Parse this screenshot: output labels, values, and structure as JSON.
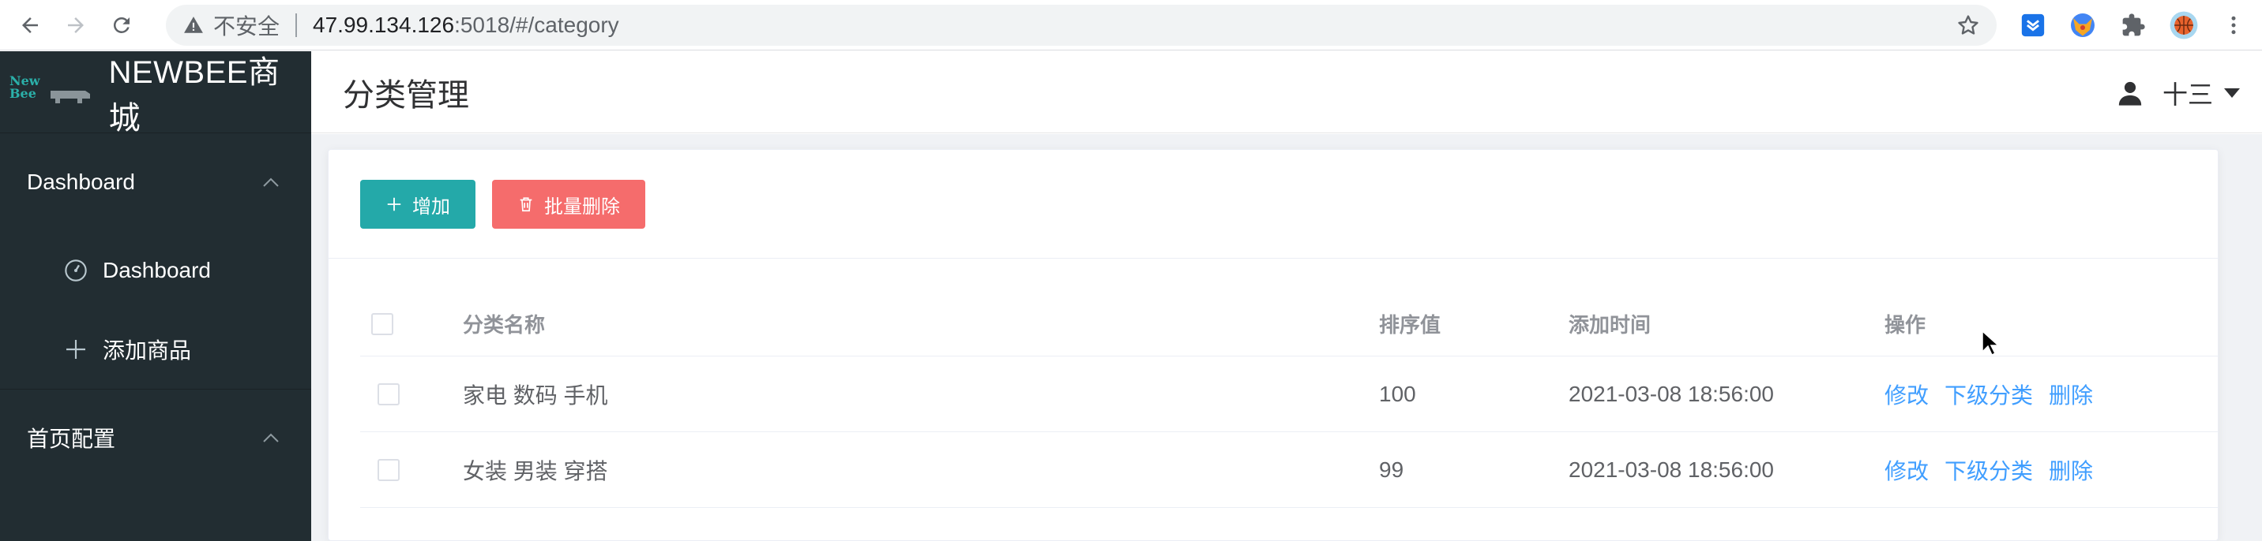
{
  "browser": {
    "insecure_label": "不安全",
    "url_host": "47.99.134.126",
    "url_path": ":5018/#/category"
  },
  "sidebar": {
    "brand": "NEWBEE商城",
    "logo_lines": [
      "New",
      "Bee"
    ],
    "groups": [
      {
        "label": "Dashboard",
        "items": [
          {
            "label": "Dashboard",
            "icon": "gauge-icon"
          },
          {
            "label": "添加商品",
            "icon": "plus-icon"
          }
        ]
      },
      {
        "label": "首页配置",
        "items": []
      }
    ]
  },
  "header": {
    "title": "分类管理",
    "user_name": "十三"
  },
  "toolbar": {
    "add_label": "增加",
    "batch_delete_label": "批量删除"
  },
  "table": {
    "columns": [
      "分类名称",
      "排序值",
      "添加时间",
      "操作"
    ],
    "rows": [
      {
        "name": "家电 数码 手机",
        "sort": "100",
        "time": "2021-03-08 18:56:00"
      },
      {
        "name": "女装 男装 穿搭",
        "sort": "99",
        "time": "2021-03-08 18:56:00"
      }
    ],
    "actions": [
      "修改",
      "下级分类",
      "删除"
    ]
  },
  "colors": {
    "sidebar_bg": "#222d32",
    "primary": "#24a9a9",
    "danger": "#f56c6c",
    "link": "#409eff"
  }
}
